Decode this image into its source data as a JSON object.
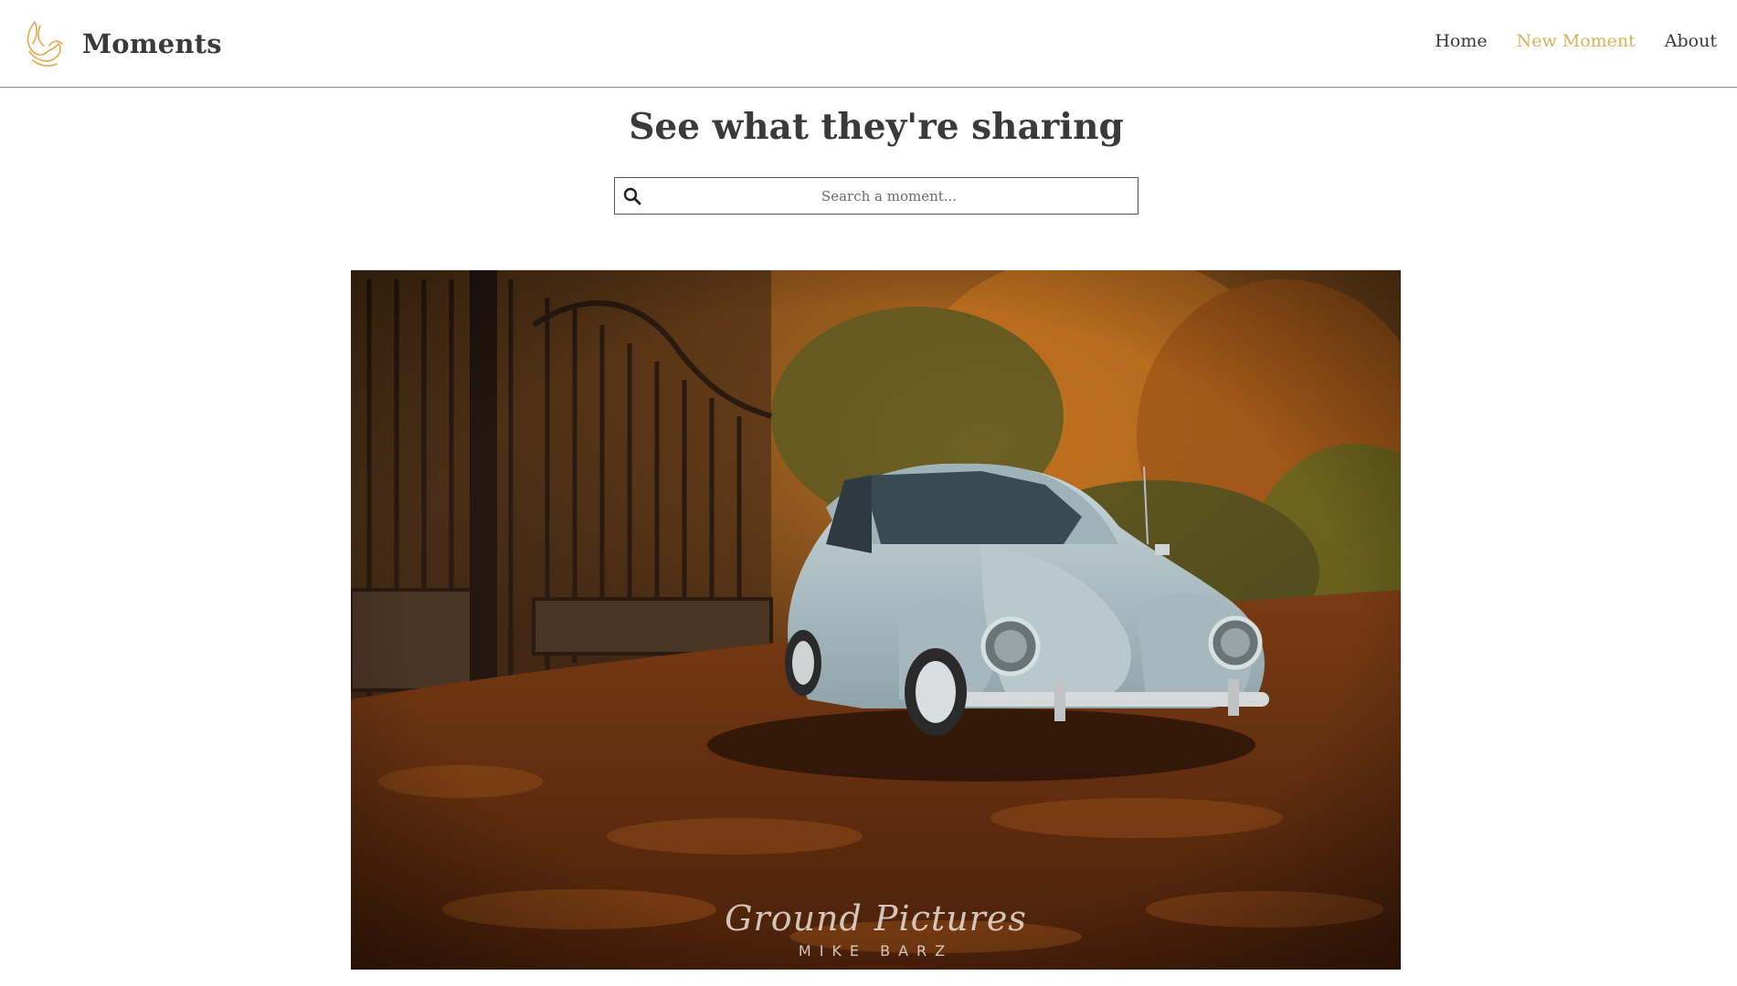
{
  "brand": {
    "name": "Moments",
    "logo_icon": "feather-hand-icon",
    "accent_color": "#d4b35a"
  },
  "nav": {
    "items": [
      {
        "label": "Home",
        "active": false
      },
      {
        "label": "New Moment",
        "active": true
      },
      {
        "label": "About",
        "active": false
      }
    ]
  },
  "main": {
    "title": "See what they're sharing",
    "search": {
      "placeholder": "Search a moment...",
      "value": "",
      "icon": "search-icon"
    },
    "moment": {
      "watermark_script": "Ground Pictures",
      "watermark_sub": "MIKE BARZ"
    }
  }
}
